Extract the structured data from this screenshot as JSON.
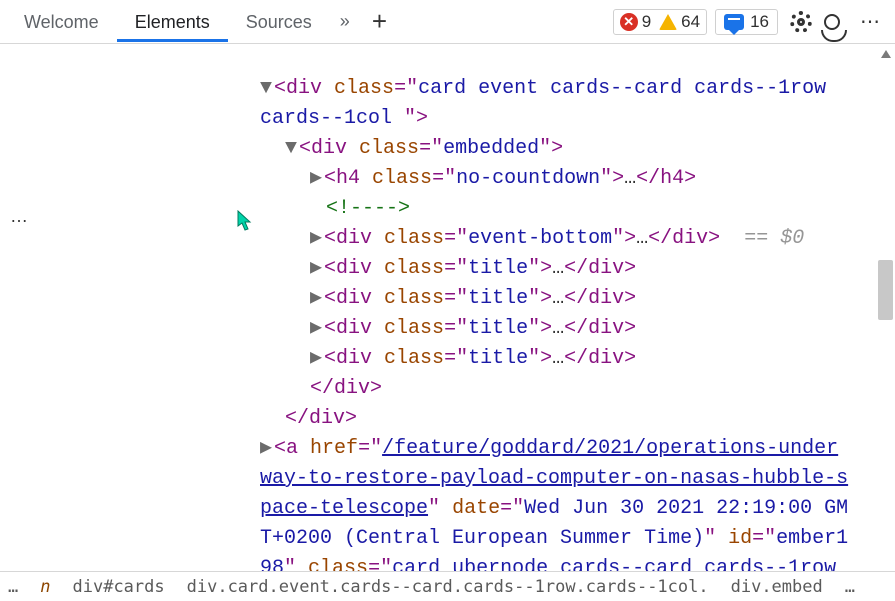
{
  "toolbar": {
    "tabs": {
      "welcome": "Welcome",
      "elements": "Elements",
      "sources": "Sources"
    },
    "errors": "9",
    "warnings": "64",
    "messages": "16"
  },
  "tree": {
    "line1": {
      "tag": "div",
      "attr": "class",
      "val_a": "card event cards--card cards--1row ",
      "val_b": "cards--1col "
    },
    "line2": {
      "tag": "div",
      "attr": "class",
      "val": "embedded"
    },
    "line3": {
      "tag_open": "h4",
      "attr": "class",
      "val": "no-countdown",
      "tag_close": "h4"
    },
    "comment": "<!---->",
    "line4": {
      "tag_open": "div",
      "attr": "class",
      "val": "event-bottom",
      "tag_close": "div",
      "marker": "== $0"
    },
    "title_lines": {
      "tag_open": "div",
      "attr": "class",
      "val": "title",
      "tag_close": "div"
    },
    "close_inner": "div",
    "close_outer": "div",
    "anchor": {
      "tag": "a",
      "href_attr": "href",
      "href_1": "/feature/goddard/2021/operations-under",
      "href_2": "way-to-restore-payload-computer-on-nasas-hubble-s",
      "href_3": "pace-telescope",
      "date_attr": "date",
      "date_1": "Wed Jun 30 2021 22:19:00 GM",
      "date_2": "T+0200 (Central European Summer Time)",
      "id_attr": "id",
      "id_1": "ember1",
      "id_2": "98",
      "cls_attr": "class",
      "cls_1": "card ubernode cards--card cards--1row"
    }
  },
  "breadcrumb": {
    "ell_l": "…",
    "c0": "n",
    "c1": "div#cards",
    "c2": "div.card.event.cards--card.cards--1row.cards--1col.",
    "c3": "div.embed",
    "ell_r": "…"
  },
  "ellipsis": "…"
}
